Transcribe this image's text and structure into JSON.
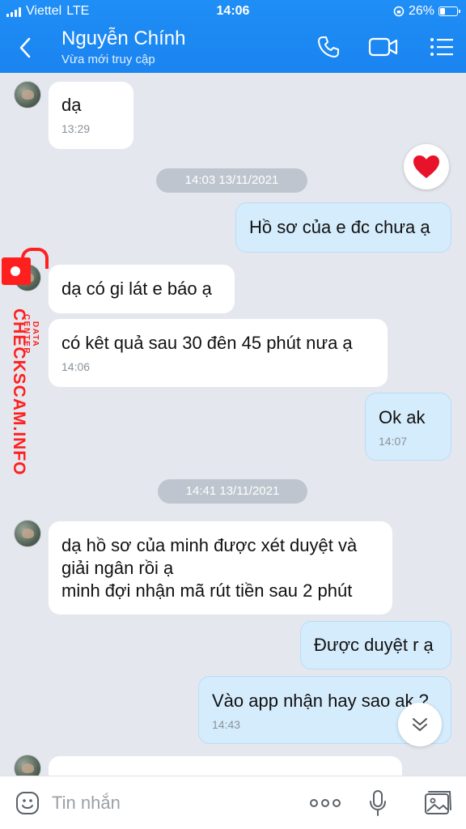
{
  "status_bar": {
    "carrier": "Viettel",
    "network": "LTE",
    "time": "14:06",
    "battery": "26%",
    "battery_level": 0.26
  },
  "header": {
    "title": "Nguyễn Chính",
    "subtitle": "Vừa mới truy cập"
  },
  "dates": [
    "14:03 13/11/2021",
    "14:41 13/11/2021"
  ],
  "messages": [
    {
      "text": "dạ",
      "time": "13:29"
    },
    {
      "text": "Hồ sơ của e đc chưa ạ"
    },
    {
      "text": "dạ có gi lát e báo ạ"
    },
    {
      "text": "có kêt quả sau 30 đên 45 phút nưa ạ",
      "time": "14:06"
    },
    {
      "text": "Ok ak",
      "time": "14:07"
    },
    {
      "text": "dạ hồ sơ của minh được xét duyệt và\ngiải ngân rồi ạ\nminh đợi nhận mã rút tiền sau 2 phút"
    },
    {
      "text": "Được duyệt r ạ"
    },
    {
      "text": "Vào app nhận hay sao ak ?",
      "time": "14:43"
    }
  ],
  "watermark": {
    "main": "CHECKSCAM.INFO",
    "sub": "DATA CENTER"
  },
  "input": {
    "placeholder": "Tin nhắn"
  },
  "colors": {
    "header": "#1a84f0",
    "outgoing_bubble": "#d5ecfc",
    "incoming_bubble": "#ffffff",
    "watermark": "#ff1f1f"
  }
}
